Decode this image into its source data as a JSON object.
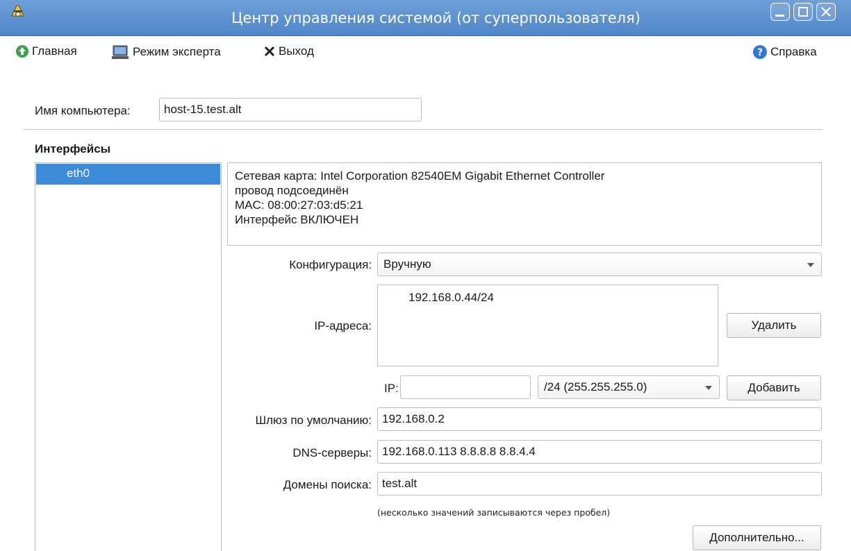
{
  "window": {
    "title": "Центр управления системой (от суперпользователя)"
  },
  "toolbar": {
    "home_label": "Главная",
    "expert_label": "Режим эксперта",
    "exit_label": "Выход",
    "help_label": "Справка"
  },
  "hostname": {
    "label": "Имя компьютера:",
    "value": "host-15.test.alt"
  },
  "interfaces": {
    "heading": "Интерфейсы",
    "items": [
      {
        "name": "eth0",
        "selected": true
      }
    ]
  },
  "info": {
    "lines": [
      "Сетевая карта: Intel Corporation 82540EM Gigabit Ethernet Controller",
      "провод подсоединён",
      "MAC: 08:00:27:03:d5:21",
      "Интерфейс ВКЛЮЧЕН"
    ]
  },
  "config": {
    "label": "Конфигурация:",
    "value": "Вручную"
  },
  "ip_addresses": {
    "label": "IP-адреса:",
    "items": [
      "192.168.0.44/24"
    ],
    "delete_label": "Удалить",
    "ip_label": "IP:",
    "ip_value": "",
    "mask_value": "/24 (255.255.255.0)",
    "add_label": "Добавить"
  },
  "gateway": {
    "label": "Шлюз по умолчанию:",
    "value": "192.168.0.2"
  },
  "dns": {
    "label": "DNS-серверы:",
    "value": "192.168.0.113 8.8.8.8 8.8.4.4"
  },
  "search_domains": {
    "label": "Домены поиска:",
    "value": "test.alt"
  },
  "hint": "(несколько значений записываются через пробел)",
  "advanced_label": "Дополнительно...",
  "colors": {
    "titlebar": "#4f86c9",
    "selection": "#3d8ad6"
  }
}
